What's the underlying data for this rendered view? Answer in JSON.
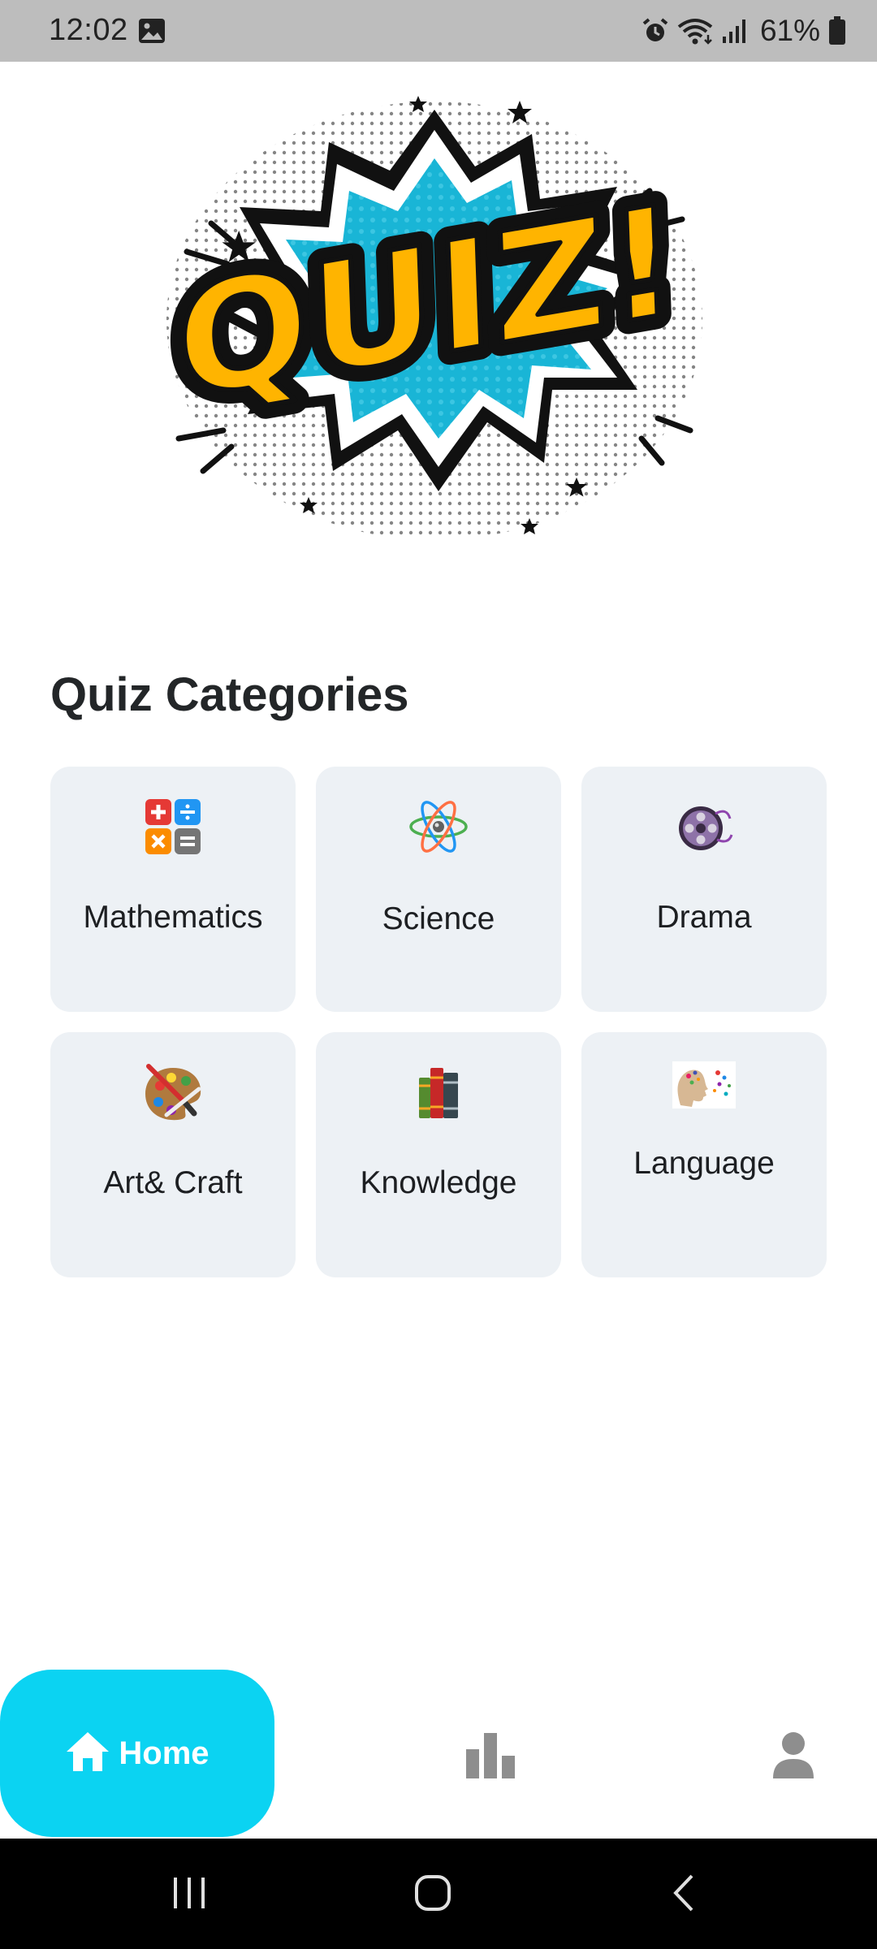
{
  "status_bar": {
    "time": "12:02",
    "battery_percent": "61%",
    "icons": [
      "gallery-icon",
      "alarm-icon",
      "wifi-icon",
      "signal-icon",
      "battery-icon"
    ]
  },
  "logo": {
    "text": "QUIZ!",
    "colors": {
      "letters": "#ffb400",
      "burst": "#19b5d6",
      "outline": "#000000"
    }
  },
  "categories_section": {
    "title": "Quiz Categories",
    "items": [
      {
        "label": "Mathematics",
        "icon": "calculator-icon"
      },
      {
        "label": "Science",
        "icon": "atom-icon"
      },
      {
        "label": "Drama",
        "icon": "film-reel-icon"
      },
      {
        "label": "Art& Craft",
        "icon": "paint-palette-icon"
      },
      {
        "label": "Knowledge",
        "icon": "books-icon"
      },
      {
        "label": "Language",
        "icon": "speaking-head-icon"
      }
    ]
  },
  "bottom_nav": {
    "home_label": "Home",
    "active": "home",
    "accent_color": "#0bd3f2",
    "items": [
      "home-icon",
      "bar-chart-icon",
      "person-icon"
    ]
  },
  "system_nav": {
    "items": [
      "recents-icon",
      "home-circle-icon",
      "back-icon"
    ]
  }
}
